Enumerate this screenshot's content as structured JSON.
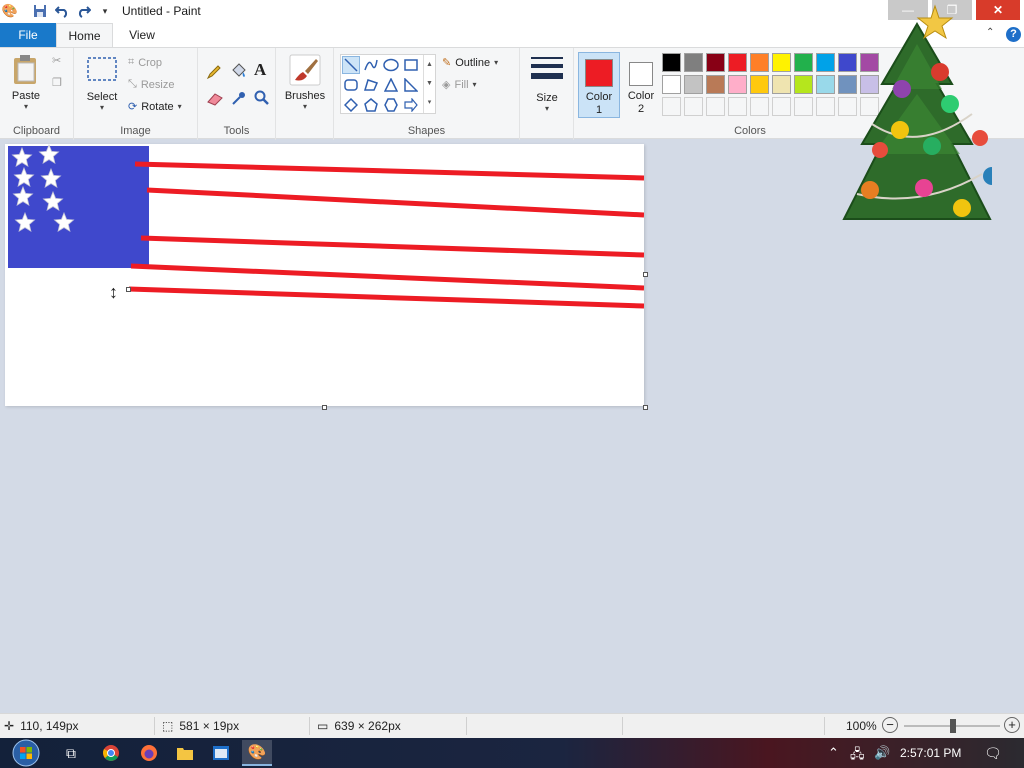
{
  "window": {
    "title": "Untitled - Paint"
  },
  "tabs": {
    "file": "File",
    "home": "Home",
    "view": "View"
  },
  "ribbon": {
    "clipboard": {
      "label": "Clipboard",
      "paste": "Paste"
    },
    "image": {
      "label": "Image",
      "select": "Select",
      "crop": "Crop",
      "resize": "Resize",
      "rotate": "Rotate"
    },
    "tools": {
      "label": "Tools"
    },
    "brushes": {
      "label": "Brushes"
    },
    "shapes": {
      "label": "Shapes",
      "outline": "Outline",
      "fill": "Fill"
    },
    "size": {
      "label": "Size"
    },
    "colors": {
      "label": "Colors",
      "color1_label": "Color 1",
      "color2_label": "Color 2",
      "color1_value": "#ed1c24",
      "color2_value": "#ffffff",
      "palette_row1": [
        "#000000",
        "#7f7f7f",
        "#880015",
        "#ed1c24",
        "#ff7f27",
        "#fff200",
        "#22b14c",
        "#00a2e8",
        "#3f48cc",
        "#a349a4"
      ],
      "palette_row2": [
        "#ffffff",
        "#c3c3c3",
        "#b97a57",
        "#ffaec9",
        "#ffc90e",
        "#efe4b0",
        "#b5e61d",
        "#99d9ea",
        "#7092be",
        "#c8bfe7"
      ]
    }
  },
  "canvas_art": {
    "union_color": "#3f48cc",
    "stripe_color": "#ed1c24",
    "star_color": "#ffffff"
  },
  "statusbar": {
    "cursor_pos": "110, 149px",
    "selection_size": "581 × 19px",
    "image_size": "639 × 262px",
    "zoom": "100%"
  },
  "taskbar": {
    "clock": "2:57:01 PM"
  }
}
